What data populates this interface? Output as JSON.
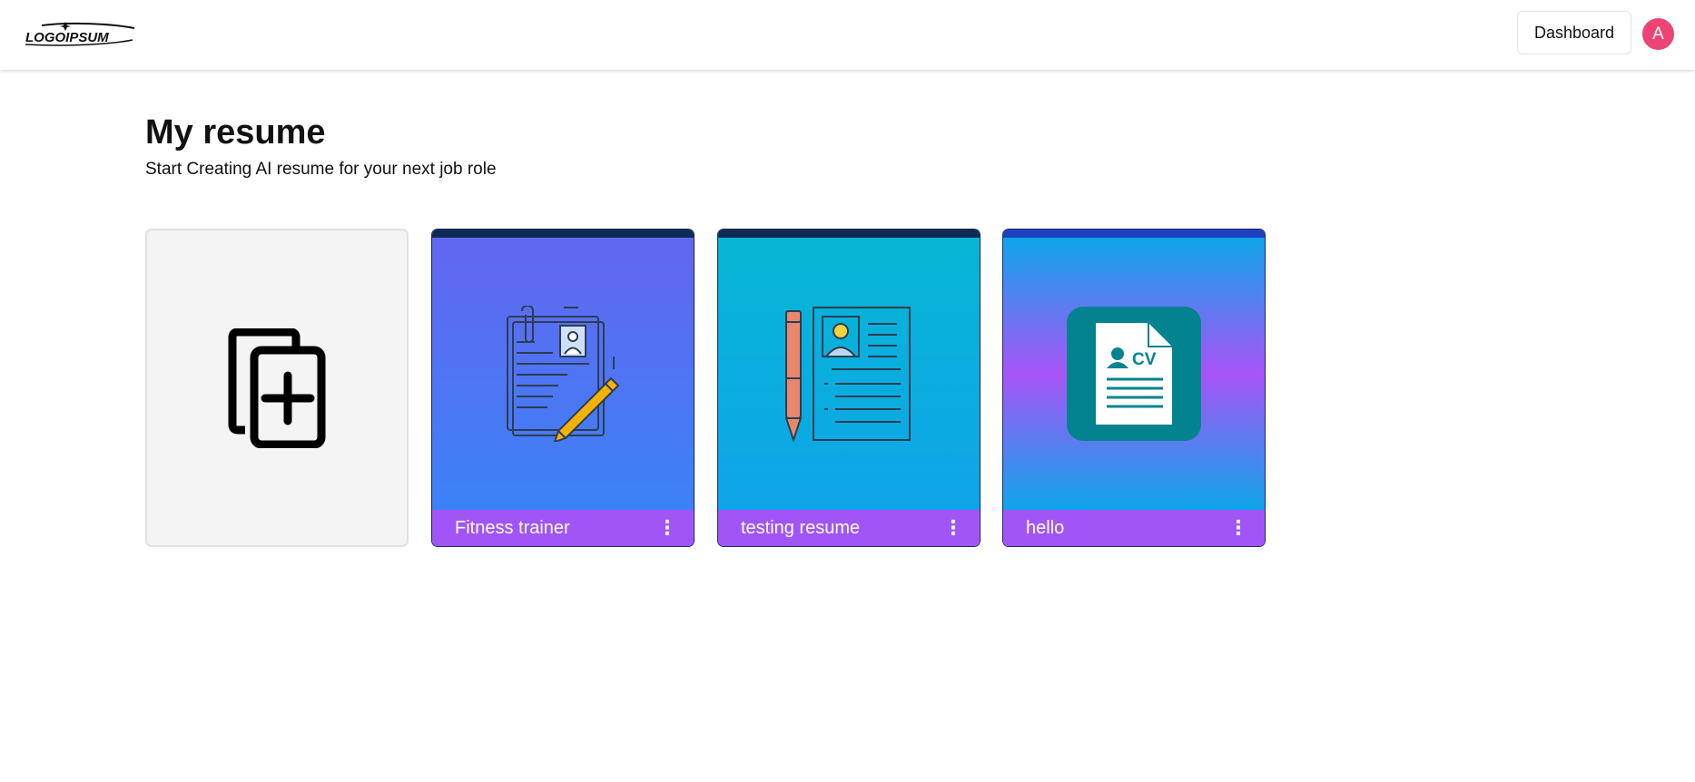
{
  "header": {
    "logo_text": "LOGOIPSUM",
    "dashboard_label": "Dashboard",
    "avatar_initial": "A"
  },
  "main": {
    "title": "My resume",
    "subtitle": "Start Creating AI resume for your next job role"
  },
  "resumes": [
    {
      "title": "Fitness trainer",
      "menu_icon": "⋮",
      "art_icon": "resume-pencil-icon"
    },
    {
      "title": "testing resume",
      "menu_icon": "⋮",
      "art_icon": "resume-pen-icon"
    },
    {
      "title": "hello",
      "menu_icon": "⋮",
      "art_icon": "cv-document-icon"
    }
  ],
  "colors": {
    "avatar": "#ec4474",
    "card_footer": "#a155f7",
    "card_border": "#1e2a5a"
  },
  "add_card_icon": "add-copy-icon"
}
